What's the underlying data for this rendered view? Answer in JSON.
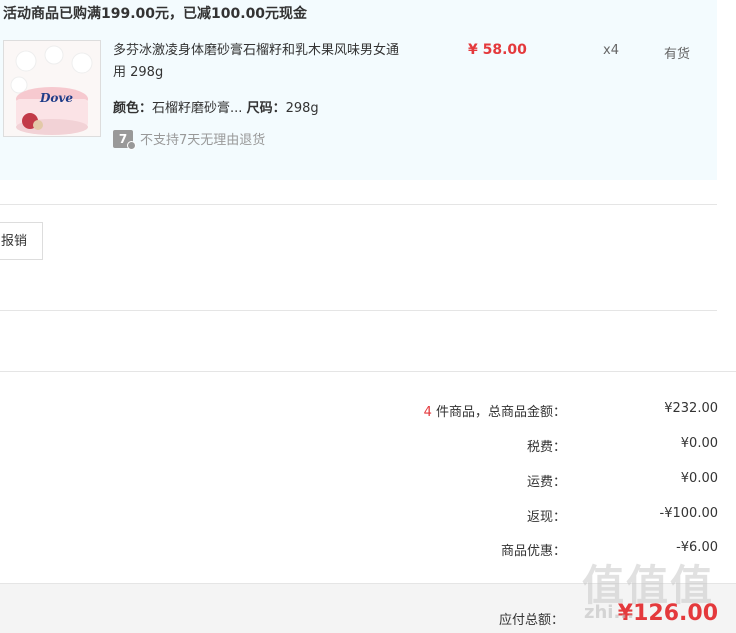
{
  "promo": {
    "title": "活动商品已购满199.00元，已减100.00元现金"
  },
  "item": {
    "thumb_brand": "Dove",
    "name": "多芬冰激凌身体磨砂膏石榴籽和乳木果风味男女通用 298g",
    "price": "¥ 58.00",
    "qty": "x4",
    "stock": "有货",
    "attr_color_label": "颜色：",
    "attr_color_value": "石榴籽磨砂膏...",
    "attr_size_label": "尺码：",
    "attr_size_value": "298g",
    "return_icon_text": "7",
    "return_policy": "不支持7天无理由退货"
  },
  "actions": {
    "reimburse_label": "报销"
  },
  "summary": {
    "items_count": "4",
    "items_label": " 件商品，总商品金额：",
    "items_value": "¥232.00",
    "tax_label": "税费：",
    "tax_value": "¥0.00",
    "shipping_label": "运费：",
    "shipping_value": "¥0.00",
    "cashback_label": "返现：",
    "cashback_value": "-¥100.00",
    "discount_label": "商品优惠：",
    "discount_value": "-¥6.00",
    "total_label": "应付总额：",
    "total_value": "¥126.00"
  },
  "watermark": {
    "glyphs": "值值值",
    "url": "zhi..."
  },
  "colors": {
    "accent_red": "#e4393c",
    "panel_bg": "#f3fbfe"
  }
}
